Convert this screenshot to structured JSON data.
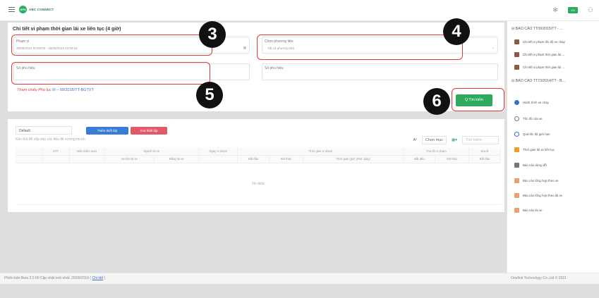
{
  "header": {
    "logo_badge": "GPS",
    "logo_text": "ABC CONNECT",
    "lang_flag": "VN"
  },
  "form": {
    "title": "Chi tiết vi phạm thời gian lái xe liên tục (4 giờ)",
    "period_label": "Phạm vi",
    "period_value": "25/08/2024 00:58:00 - 25/08/2024 23:59:59",
    "vehicle_label": "Chọn phương tiện",
    "vehicle_placeholder": "Tất cả phương tiện",
    "plate_label": "Số phù hiệu",
    "badge_label": "Số phù hiệu",
    "reference_prefix": "Tham chiếu Phụ lục",
    "reference_link": "III – 09/2015/TT-BGTVT",
    "search_button": "Q Tìm kiếm"
  },
  "annotations": [
    "3",
    "4",
    "5",
    "6"
  ],
  "table": {
    "preset": "Default",
    "save_preset": "Thêm thiết lập",
    "delete_preset": "Xóa thiết lập",
    "hint": "Kéo thả để sắp xếp các tiêu đề xương muốn",
    "choose_label": "Chọn mục",
    "search_placeholder": "Tìm kiếm",
    "headers": [
      "",
      "STT",
      "Biển kiểm soát",
      "Người lái xe",
      "Ngày vi phạm",
      "Thời gian vi phạm",
      "Tọa độ vi phạm",
      "Địa đi"
    ],
    "subheaders": [
      "Họ tên lái xe",
      "Bằng lái xe",
      "Bắt đầu",
      "Kết thúc",
      "Thời gian (giờ: phút: giây)",
      "Bắt đầu",
      "Kết thúc",
      "Bắt đầu"
    ],
    "empty_text": "No data"
  },
  "panel": {
    "section1": "BÁO CÁO TT09/2015/TT - ...",
    "items1": [
      {
        "label": "Chi tiết vi phạm tốc độ xe chạy",
        "icon": "report-icon"
      },
      {
        "label": "Chi tiết vi phạm thời gian lái ...",
        "icon": "report-icon"
      },
      {
        "label": "Chi tiết vi phạm thời gian lái ...",
        "icon": "report-icon"
      }
    ],
    "section2": "BÁO CÁO TT73/2014/TT - B...",
    "items2": [
      {
        "label": "Hành trình xe chạy",
        "icon": "route-icon",
        "color": "#3a6fc4"
      },
      {
        "label": "Tốc độ của xe",
        "icon": "speed-icon",
        "color": "#777"
      },
      {
        "label": "Quá tốc độ giới hạn",
        "icon": "overspeed-icon",
        "color": "#3a6fc4"
      },
      {
        "label": "Thời gian lái xe liên tục",
        "icon": "timer-icon",
        "color": "#f0a020"
      },
      {
        "label": "Báo cáo dừng đỗ",
        "icon": "stop-icon",
        "color": "#777"
      },
      {
        "label": "Báo cáo tổng hợp theo xe",
        "icon": "summary-icon",
        "color": "#e23a3a"
      },
      {
        "label": "Báo cáo tổng hợp theo lái xe",
        "icon": "summary-icon",
        "color": "#e23a3a"
      },
      {
        "label": "Báo cáo lái xe",
        "icon": "driver-icon",
        "color": "#e23a3a"
      }
    ]
  },
  "footer": {
    "version_text": "Phiên bản Beta 2.0.00 Cập nhật mới nhất: 20/09/2019",
    "detail_link": "Chi tiết",
    "copyright": "Onefink Technology Co.,Ltd © 2021"
  },
  "colors": {
    "green": "#2eaa5e",
    "red_annotation": "#e23a3a",
    "blue": "#3a6fc4"
  }
}
